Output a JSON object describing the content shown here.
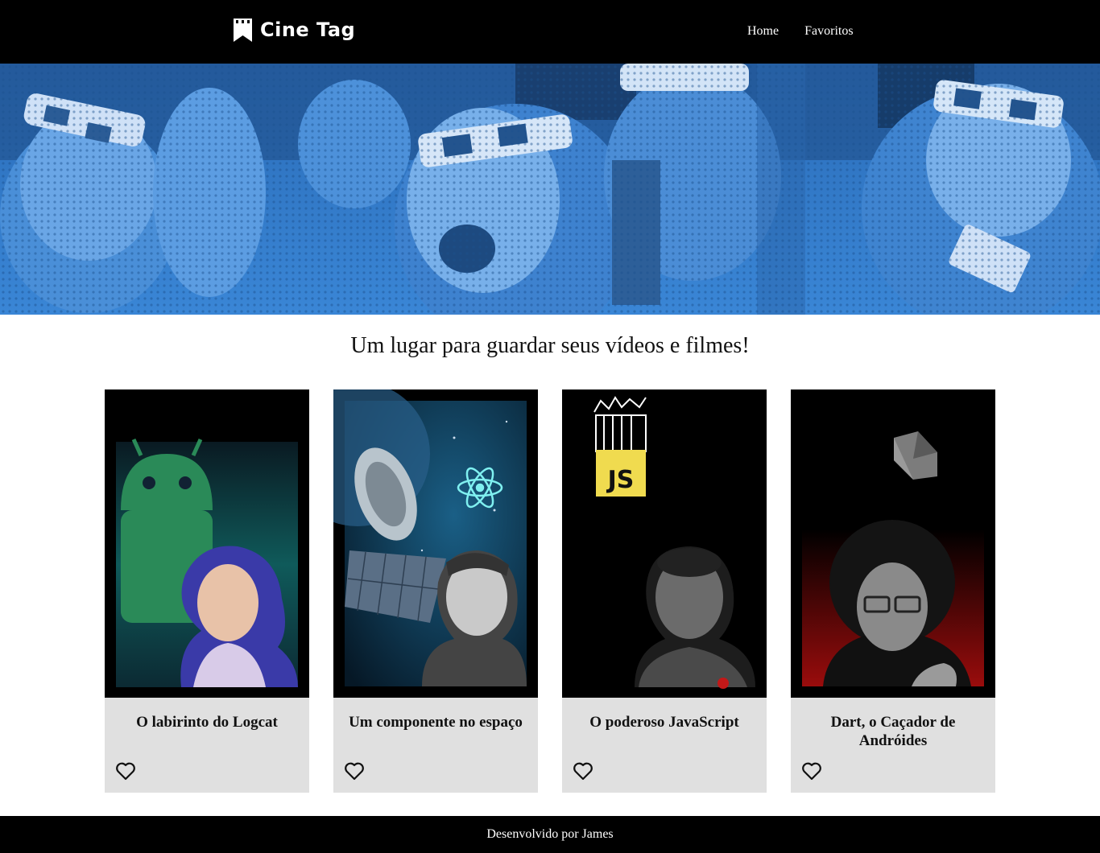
{
  "header": {
    "logo_text": "Cine Tag",
    "nav": [
      {
        "label": "Home"
      },
      {
        "label": "Favoritos"
      }
    ]
  },
  "main": {
    "title": "Um lugar para guardar seus vídeos e filmes!",
    "cards": [
      {
        "title": "O labirinto do Logcat",
        "favorite": false
      },
      {
        "title": "Um componente no espaço",
        "favorite": false
      },
      {
        "title": "O poderoso JavaScript",
        "favorite": false,
        "badge": "JS"
      },
      {
        "title": "Dart, o Caçador de Andróides",
        "favorite": false
      }
    ]
  },
  "footer": {
    "text": "Desenvolvido por James"
  },
  "colors": {
    "header_bg": "#000000",
    "banner_blue": "#2f78c8",
    "card_bg": "#e0e0e0",
    "js_yellow": "#f0db4f"
  }
}
